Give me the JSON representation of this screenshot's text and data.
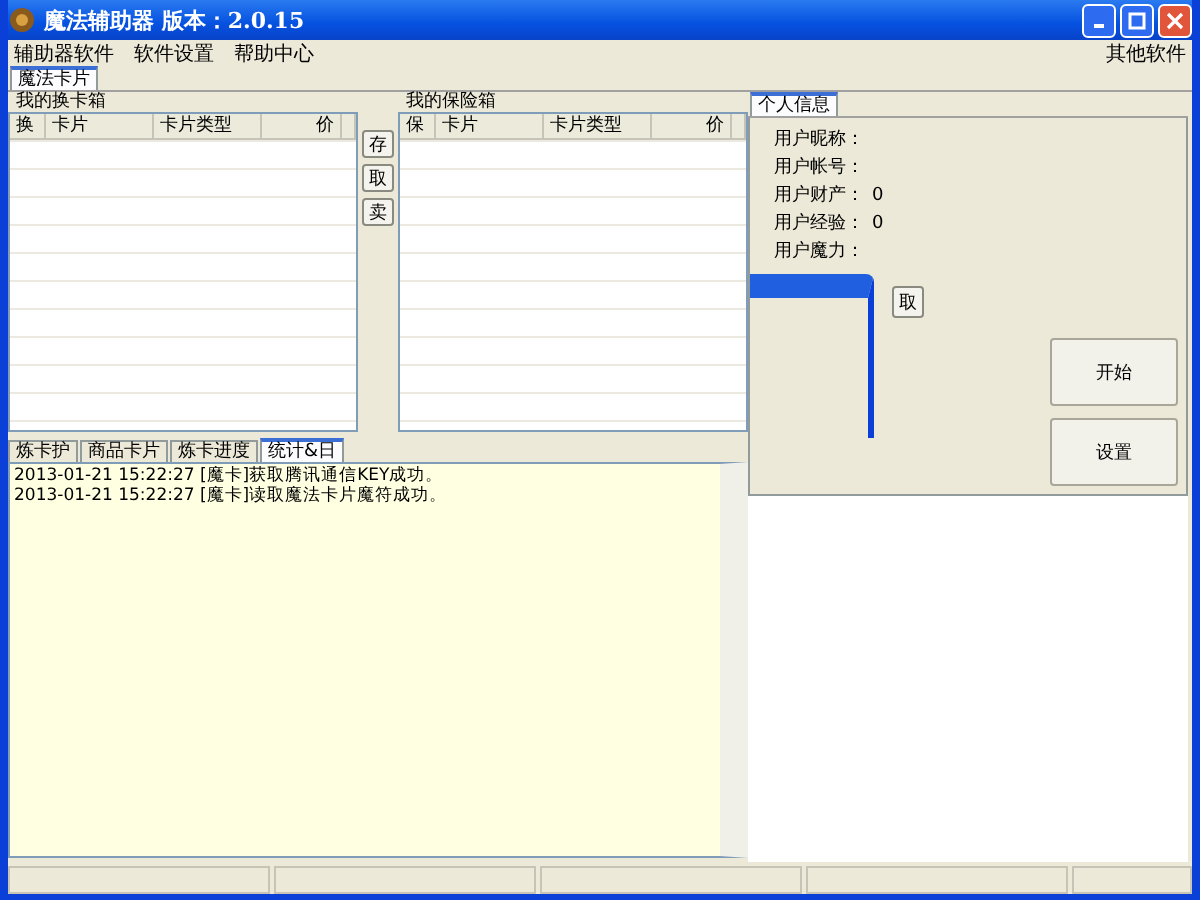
{
  "window": {
    "title": "魔法辅助器 版本：2.0.15"
  },
  "menu": {
    "items": [
      "辅助器软件",
      "软件设置",
      "帮助中心"
    ],
    "right_item": "其他软件"
  },
  "main_tabs": [
    {
      "label": "魔法卡片",
      "selected": true
    }
  ],
  "exchange_box": {
    "title": "我的换卡箱",
    "columns": [
      "换",
      "卡片",
      "卡片类型",
      "价"
    ]
  },
  "transfer_buttons": [
    "存",
    "取",
    "卖"
  ],
  "safe_box": {
    "title": "我的保险箱",
    "columns": [
      "保",
      "卡片",
      "卡片类型",
      "价"
    ]
  },
  "bottom_tabs": [
    {
      "label": "炼卡护",
      "selected": false
    },
    {
      "label": "商品卡片",
      "selected": false
    },
    {
      "label": "炼卡进度",
      "selected": false
    },
    {
      "label": "统计&日",
      "selected": true
    }
  ],
  "log": [
    "2013-01-21 15:22:27 [魔卡]获取腾讯通信KEY成功。",
    "2013-01-21 15:22:27 [魔卡]读取魔法卡片魔符成功。"
  ],
  "info_tabs": [
    {
      "label": "个人信息",
      "selected": true
    }
  ],
  "user_info": [
    {
      "label": "用户昵称："
    },
    {
      "label": "用户帐号："
    },
    {
      "label": "用户财产：",
      "value": "0"
    },
    {
      "label": "用户经验：",
      "value": "0"
    },
    {
      "label": "用户魔力："
    }
  ],
  "fetch_button": "取",
  "action_buttons": [
    "开始",
    "设置"
  ]
}
